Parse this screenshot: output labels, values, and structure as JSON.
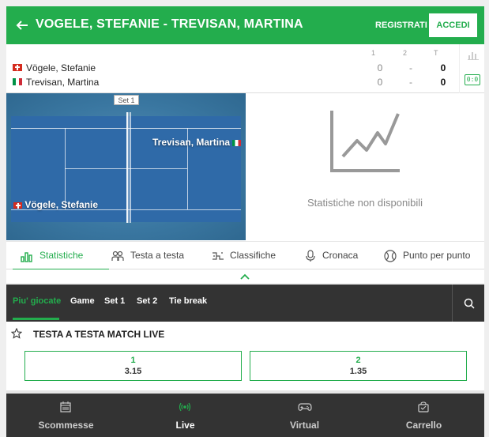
{
  "header": {
    "title": "VOGELE, STEFANIE - TREVISAN, MARTINA",
    "registrati": "REGISTRATI",
    "accedi": "ACCEDI"
  },
  "scoreboard": {
    "columns": [
      "1",
      "2",
      "T"
    ],
    "players": [
      {
        "name": "Vögele, Stefanie",
        "flag": "switzerland-flag",
        "set1": "0",
        "set2": "-",
        "total": "0"
      },
      {
        "name": "Trevisan, Martina",
        "flag": "italy-flag",
        "set1": "0",
        "set2": "-",
        "total": "0"
      }
    ],
    "scoreboard_icon_text": "0:0"
  },
  "court": {
    "set_label": "Set 1",
    "player_top": "Trevisan, Martina",
    "player_bottom": "Vögele, Stefanie"
  },
  "stats": {
    "empty_message": "Statistiche non disponibili"
  },
  "tabs": [
    {
      "label": "Statistiche",
      "icon": "bar-chart-icon",
      "active": true
    },
    {
      "label": "Testa a testa",
      "icon": "people-icon",
      "active": false
    },
    {
      "label": "Classifiche",
      "icon": "ranking-icon",
      "active": false
    },
    {
      "label": "Cronaca",
      "icon": "microphone-icon",
      "active": false
    },
    {
      "label": "Punto per punto",
      "icon": "tennis-ball-icon",
      "active": false
    }
  ],
  "filters": [
    {
      "label": "Piu' giocate",
      "active": true
    },
    {
      "label": "Game",
      "active": false
    },
    {
      "label": "Set 1",
      "active": false
    },
    {
      "label": "Set 2",
      "active": false
    },
    {
      "label": "Tie break",
      "active": false
    }
  ],
  "market": {
    "title": "TESTA A TESTA MATCH LIVE",
    "outcomes": [
      {
        "selection": "1",
        "odds": "3.15"
      },
      {
        "selection": "2",
        "odds": "1.35"
      }
    ]
  },
  "bottom_nav": [
    {
      "label": "Scommesse",
      "icon": "calendar-icon",
      "active": false
    },
    {
      "label": "Live",
      "icon": "live-signal-icon",
      "active": true
    },
    {
      "label": "Virtual",
      "icon": "gamepad-icon",
      "active": false
    },
    {
      "label": "Carrello",
      "icon": "cart-icon",
      "active": false
    }
  ],
  "colors": {
    "brand_green": "#23ad4d",
    "dark_bar": "#333333",
    "court_blue": "#2f6aa8"
  }
}
